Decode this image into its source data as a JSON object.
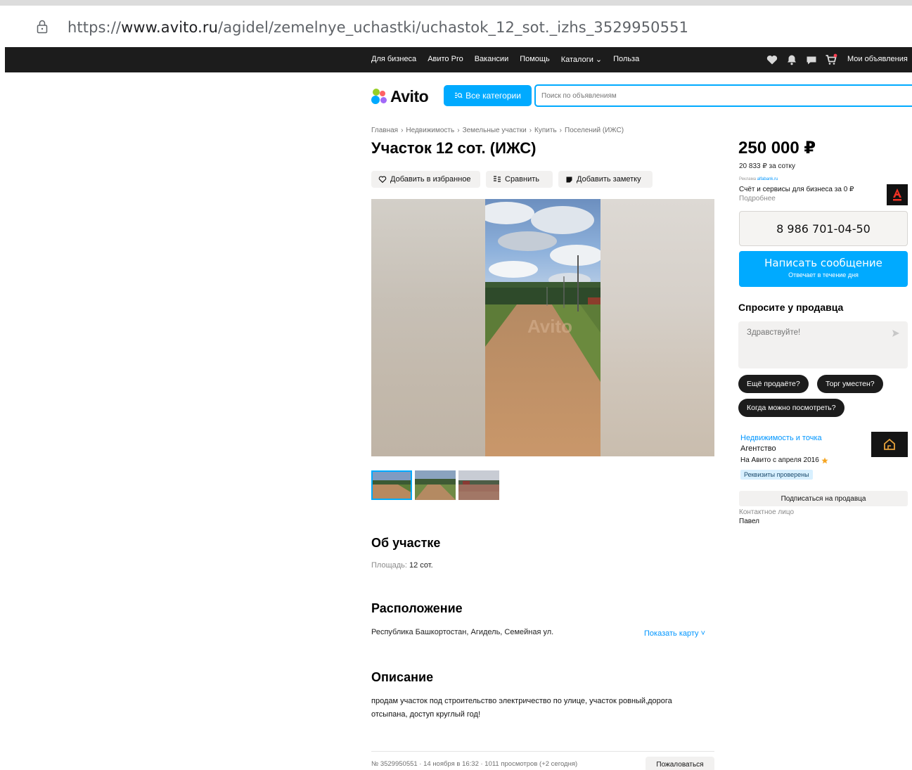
{
  "browser": {
    "url_prefix": "https://",
    "url_host": "www.avito.ru",
    "url_path": "/agidel/zemelnye_uchastki/uchastok_12_sot._izhs_3529950551"
  },
  "topnav": {
    "links": [
      "Для бизнеса",
      "Авито Pro",
      "Вакансии",
      "Помощь",
      "Каталоги ⌄",
      "Польза"
    ],
    "my_ads": "Мои объявления"
  },
  "header": {
    "logo_text": "Avito",
    "categories_button": "Все категории",
    "search_placeholder": "Поиск по объявлениям"
  },
  "breadcrumbs": [
    "Главная",
    "Недвижимость",
    "Земельные участки",
    "Купить",
    "Поселений (ИЖС)"
  ],
  "listing": {
    "title": "Участок 12 сот. (ИЖС)",
    "actions": {
      "favorite": "Добавить в избранное",
      "compare": "Сравнить",
      "note": "Добавить заметку"
    },
    "about": {
      "heading": "Об участке",
      "area_label": "Площадь:",
      "area_value": "12 сот."
    },
    "location": {
      "heading": "Расположение",
      "address": "Республика Башкортостан, Агидель, Семейная ул.",
      "show_map": "Показать карту ˅"
    },
    "description": {
      "heading": "Описание",
      "text": "продам участок под строительство электричество по улице, участок ровный,дорога отсыпана, доступ круглый год!"
    },
    "footer": {
      "meta": "№ 3529950551 · 14 ноября в 16:32 · 1011 просмотров (+2 сегодня)",
      "complain": "Пожаловаться"
    }
  },
  "sidebar": {
    "price": "250 000 ₽",
    "price_per_unit": "20 833 ₽ за сотку",
    "ad_label": "Реклама",
    "ad_source": "alfabank.ru",
    "ad_title": "Счёт и сервисы для бизнеса за 0 ₽",
    "ad_more": "Подробнее",
    "phone": "8 986 701-04-50",
    "message_button": "Написать сообщение",
    "message_subtitle": "Отвечает в течение дня",
    "ask_heading": "Спросите у продавца",
    "ask_placeholder": "Здравствуйте!",
    "quick_questions": [
      "Ещё продаёте?",
      "Торг уместен?",
      "Когда можно посмотреть?"
    ],
    "seller": {
      "name": "Недвижимость и точка",
      "type": "Агентство",
      "since": "На Авито с апреля 2016",
      "verified": "Реквизиты проверены",
      "subscribe": "Подписаться на продавца",
      "contact_label": "Контактное лицо",
      "contact_name": "Павел"
    }
  },
  "colors": {
    "accent": "#00aaff",
    "topnav_bg": "#1c1c1c",
    "chip_bg": "#1c1c1c",
    "button_gray": "#f2f1f0"
  },
  "icons": [
    "lock-icon",
    "heart-icon",
    "bell-icon",
    "chat-icon",
    "cart-icon",
    "compare-icon",
    "note-icon",
    "send-icon",
    "star-icon",
    "house-icon",
    "alfa-logo"
  ]
}
